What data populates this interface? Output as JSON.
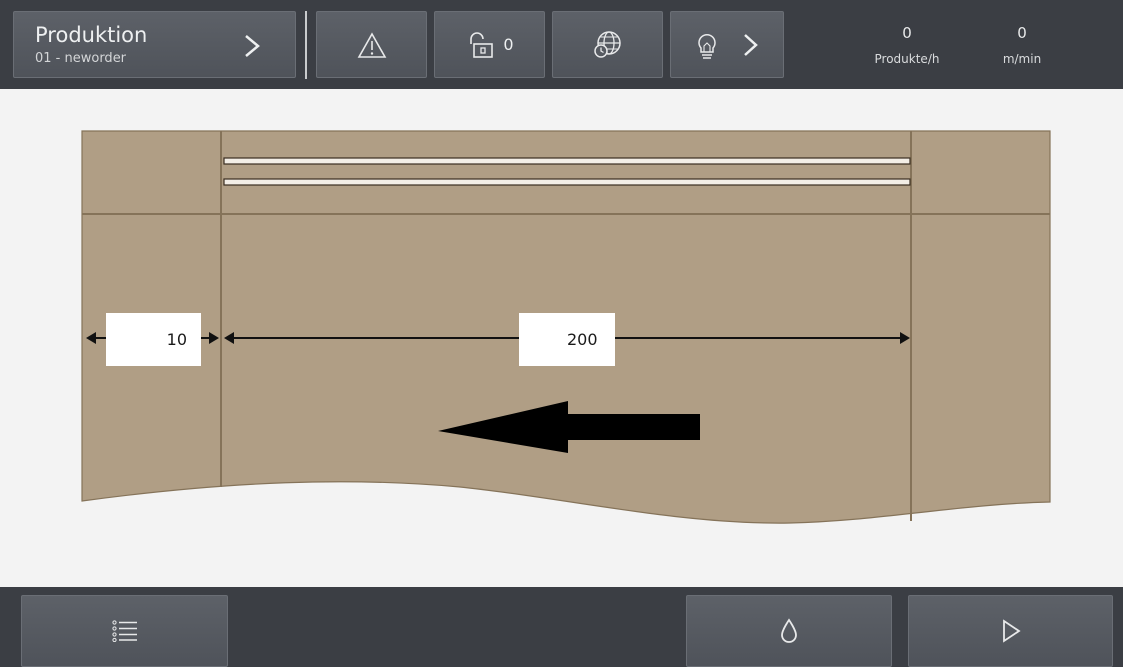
{
  "header": {
    "production_title": "Produktion",
    "production_order": "01 - neworder",
    "lock_count": "0",
    "rate_value": "0",
    "rate_label": "Produkte/h",
    "speed_value": "0",
    "speed_label": "m/min"
  },
  "icons": {
    "production_next": "chevron-right-icon",
    "warning": "warning-triangle-icon",
    "lock": "unlock-icon",
    "globe": "globe-clock-icon",
    "bulb": "lightbulb-icon",
    "bulb_next": "chevron-right-icon",
    "list": "list-icon",
    "drop": "drop-icon",
    "play": "play-icon"
  },
  "diagram": {
    "left_margin_value": "10",
    "width_value": "200",
    "material_color": "#b09e85",
    "line_color": "#857359"
  }
}
